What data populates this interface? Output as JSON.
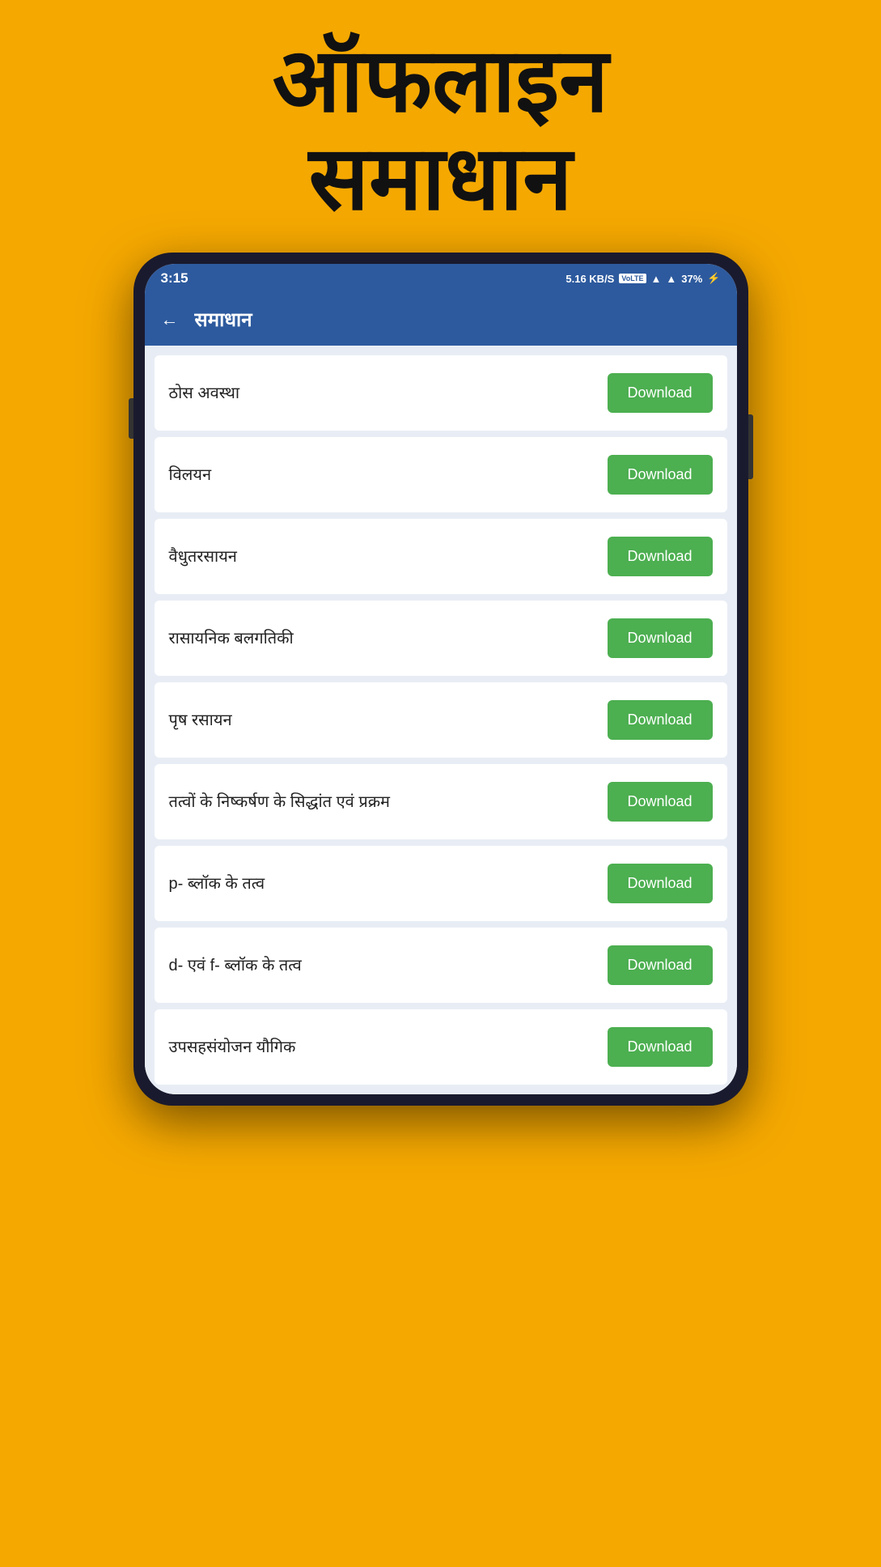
{
  "hero": {
    "line1": "ऑफलाइन",
    "line2": "समाधान"
  },
  "status_bar": {
    "time": "3:15",
    "speed": "5.16 KB/S",
    "volte": "VoLTE",
    "battery": "37%"
  },
  "app_bar": {
    "title": "समाधान",
    "back_label": "←"
  },
  "download_label": "Download",
  "items": [
    {
      "id": 1,
      "title": "ठोस अवस्था"
    },
    {
      "id": 2,
      "title": "विलयन"
    },
    {
      "id": 3,
      "title": "वैधुतरसायन"
    },
    {
      "id": 4,
      "title": "रासायनिक बलगतिकी"
    },
    {
      "id": 5,
      "title": "पृष रसायन"
    },
    {
      "id": 6,
      "title": "तत्वों के निष्कर्षण के सिद्धांत एवं प्रक्रम"
    },
    {
      "id": 7,
      "title": "p- ब्लॉक के तत्व"
    },
    {
      "id": 8,
      "title": "d- एवं f- ब्लॉक के तत्व"
    },
    {
      "id": 9,
      "title": "उपसहसंयोजन यौगिक"
    }
  ]
}
